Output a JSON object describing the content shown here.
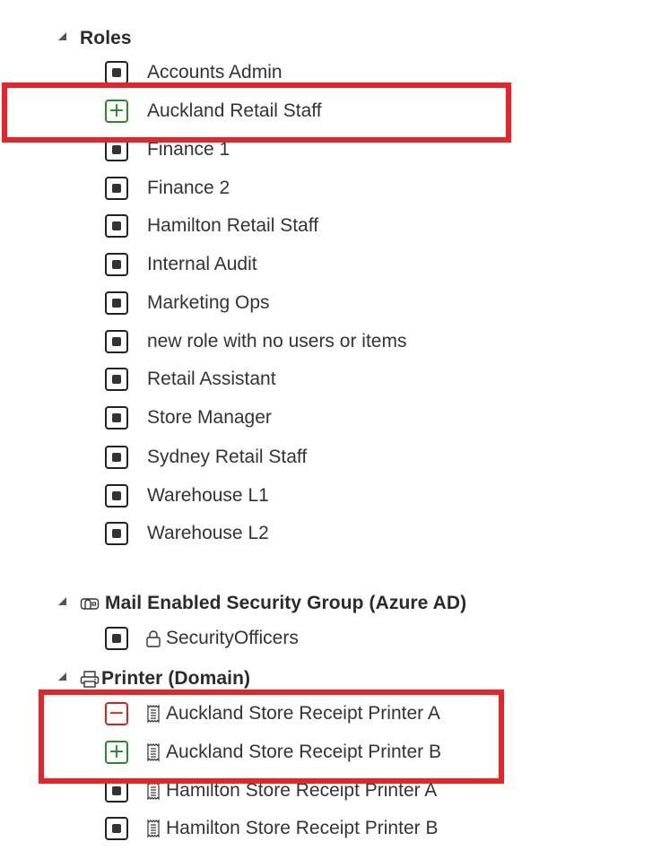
{
  "groups": [
    {
      "label": "Roles",
      "icon": "none",
      "expanded": true,
      "items": [
        {
          "label": "Accounts Admin",
          "state": "unchanged"
        },
        {
          "label": "Auckland Retail Staff",
          "state": "added"
        },
        {
          "label": "Finance 1",
          "state": "unchanged"
        },
        {
          "label": "Finance 2",
          "state": "unchanged"
        },
        {
          "label": "Hamilton Retail Staff",
          "state": "unchanged"
        },
        {
          "label": "Internal Audit",
          "state": "unchanged"
        },
        {
          "label": "Marketing Ops",
          "state": "unchanged"
        },
        {
          "label": "new role with no users or items",
          "state": "unchanged"
        },
        {
          "label": "Retail Assistant",
          "state": "unchanged"
        },
        {
          "label": "Store Manager",
          "state": "unchanged"
        },
        {
          "label": "Sydney Retail Staff",
          "state": "unchanged"
        },
        {
          "label": "Warehouse L1",
          "state": "unchanged"
        },
        {
          "label": "Warehouse L2",
          "state": "unchanged"
        }
      ]
    },
    {
      "label": "Mail Enabled Security Group (Azure AD)",
      "icon": "mailbox-icon",
      "expanded": true,
      "items": [
        {
          "label": "SecurityOfficers",
          "state": "unchanged",
          "icon": "lock-icon"
        }
      ]
    },
    {
      "label": "Printer (Domain)",
      "icon": "printer-icon",
      "expanded": true,
      "items": [
        {
          "label": "Auckland Store Receipt Printer A",
          "state": "removed",
          "icon": "receipt-icon"
        },
        {
          "label": "Auckland Store Receipt Printer B",
          "state": "added",
          "icon": "receipt-icon"
        },
        {
          "label": "Hamilton Store Receipt Printer A",
          "state": "unchanged",
          "icon": "receipt-icon"
        },
        {
          "label": "Hamilton Store Receipt Printer B",
          "state": "unchanged",
          "icon": "receipt-icon"
        }
      ]
    }
  ],
  "symbols": {
    "added": "+",
    "removed": "−"
  },
  "colors": {
    "added": "#1f8a1f",
    "removed": "#e02020",
    "highlight": "#e8232a"
  }
}
